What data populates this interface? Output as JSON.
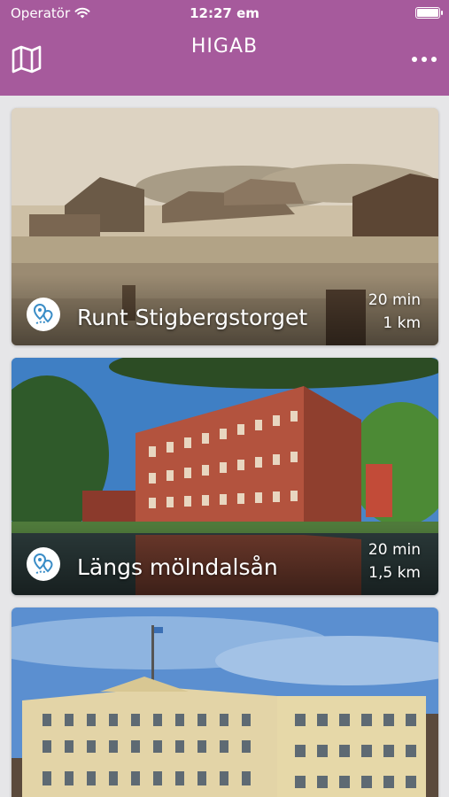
{
  "status_bar": {
    "carrier": "Operatör",
    "time": "12:27 em"
  },
  "nav": {
    "title": "HIGAB",
    "left_icon": "map-icon",
    "right_icon": "more-icon"
  },
  "colors": {
    "accent": "#a65a9c",
    "pin_blue": "#3a8dc7",
    "background": "#e6e6e8"
  },
  "tours": [
    {
      "title": "Runt Stigbergstorget",
      "duration": "20 min",
      "distance": "1 km",
      "icon": "tour-pin-icon"
    },
    {
      "title": "Längs mölndalsån",
      "duration": "20 min",
      "distance": "1,5 km",
      "icon": "tour-pin-icon"
    },
    {
      "title": "",
      "duration": "",
      "distance": "",
      "icon": ""
    }
  ]
}
